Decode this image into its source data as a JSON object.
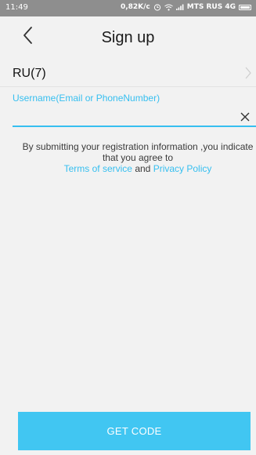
{
  "status_bar": {
    "time": "11:49",
    "speed": "0,82K/c",
    "carrier": "MTS RUS 4G"
  },
  "header": {
    "title": "Sign up",
    "back_icon": "chevron-left-icon"
  },
  "country": {
    "label": "RU(7)",
    "icon": "chevron-right-icon"
  },
  "username": {
    "label": "Username(Email or PhoneNumber)",
    "value": "",
    "clear_icon": "close-icon"
  },
  "legal": {
    "line1": "By submitting your registration information ,you indicate",
    "line2": "that you agree to",
    "terms_link": "Terms of service",
    "and": "and",
    "privacy_link": "Privacy Policy"
  },
  "action": {
    "get_code_label": "GET CODE"
  },
  "colors": {
    "accent": "#36bff0",
    "button": "#41c6f2",
    "background": "#f2f2f2",
    "status_bar": "#8e8e8e"
  }
}
